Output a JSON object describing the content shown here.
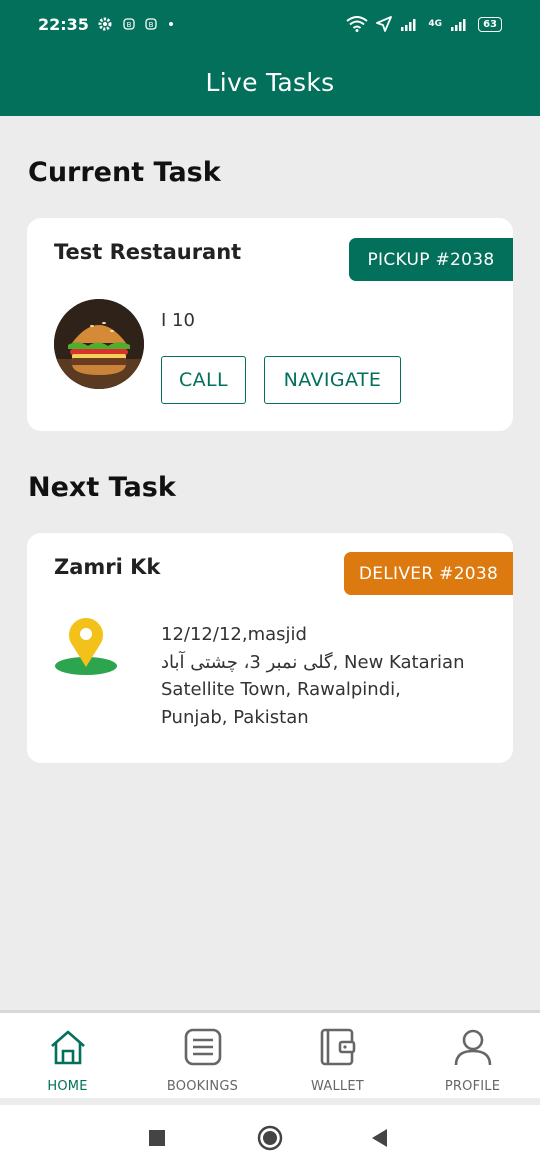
{
  "status_bar": {
    "time": "22:35",
    "network": "4G",
    "battery": "63"
  },
  "app_bar": {
    "title": "Live Tasks"
  },
  "current_task": {
    "section_title": "Current Task",
    "restaurant_name": "Test Restaurant",
    "badge": "PICKUP #2038",
    "address": "I 10",
    "call_label": "CALL",
    "navigate_label": "NAVIGATE"
  },
  "next_task": {
    "section_title": "Next Task",
    "customer_name": "Zamri Kk",
    "badge": "DELIVER #2038",
    "address_lines": [
      "12/12/12,masjid",
      "گلی نمبر 3، چشتی آباد, New Katarian",
      "Satellite Town, Rawalpindi,",
      "Punjab, Pakistan"
    ]
  },
  "bottom_nav": {
    "items": [
      {
        "label": "HOME",
        "icon": "home-icon",
        "active": true
      },
      {
        "label": "BOOKINGS",
        "icon": "list-icon",
        "active": false
      },
      {
        "label": "WALLET",
        "icon": "wallet-icon",
        "active": false
      },
      {
        "label": "PROFILE",
        "icon": "person-icon",
        "active": false
      }
    ]
  },
  "colors": {
    "primary": "#02705a",
    "deliver": "#dd7a0f",
    "background": "#ececec"
  }
}
